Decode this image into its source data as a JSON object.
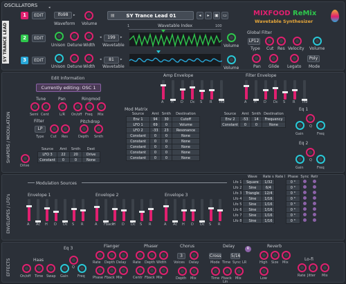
{
  "header": {
    "title": "OSCILLATORS",
    "preset_name": "SY Trance Lead 01"
  },
  "brand": {
    "name_a": "MIXFOOD",
    "name_b": "ReMix",
    "subtitle": "Wavetable Synthesizer",
    "vertical_logo": "SY TRANCE LEAD"
  },
  "colors": {
    "accent_pink": "#e0206f",
    "accent_cyan": "#28c9d8",
    "osc1": "#e0206f",
    "osc2": "#2ec74c",
    "osc3": "#28a7d8"
  },
  "osc1": {
    "num": "1",
    "edit": "EDIT",
    "waveform_value": "lfo98",
    "waveform_label": "Waveform",
    "volume_label": "Volume"
  },
  "osc2": {
    "num": "2",
    "edit": "EDIT",
    "wavetable_value": "199",
    "labels": [
      "Unison",
      "Detune",
      "Width",
      "Wavetable",
      "Volume"
    ]
  },
  "osc3": {
    "num": "3",
    "edit": "EDIT",
    "wavetable_value": "81",
    "labels": [
      "Unison",
      "Detune",
      "Width",
      "Wavetable",
      "Volume"
    ]
  },
  "wavetable_index": {
    "label": "Wavetable Index",
    "min": "1",
    "max": "100"
  },
  "global_filter": {
    "title": "Global Filter",
    "type_value": "LP12",
    "type_label": "Type",
    "cut_label": "Cut",
    "res_label": "Res",
    "velocity_label": "Velocity",
    "volume_label": "Volume",
    "pan_label": "Pan",
    "glide_label": "Glide",
    "legato_label": "Legato",
    "mode_value": "Poly",
    "mode_label": "Mode"
  },
  "edit_info": {
    "title": "Edit Information",
    "currently": "Currently editing: OSC 1"
  },
  "tune": {
    "title": "Tune",
    "semi": "Semi",
    "cent": "Cent"
  },
  "pan": {
    "title": "Pan",
    "lr": "L/R"
  },
  "ringmod": {
    "title": "Ringmod",
    "onoff": "On/off",
    "freq": "Freq",
    "mix": "Mix"
  },
  "filter": {
    "title": "Filter",
    "type_value": "LP",
    "type": "Type",
    "cut": "Cut",
    "res": "Res"
  },
  "pitchdrop": {
    "title": "Pitchdrop",
    "depth": "Depth",
    "smth": "Smth"
  },
  "drive": {
    "label": "Drive"
  },
  "source_table": {
    "headers": [
      "Source",
      "Amt",
      "Smth",
      "Dest"
    ],
    "rows": [
      [
        "LFO 3",
        "22",
        "20",
        "Drive"
      ],
      [
        "Constant",
        "0",
        "0",
        "None"
      ]
    ]
  },
  "amp_envelope": {
    "title": "Amp Envelope",
    "labels": [
      "A",
      "H",
      "D",
      "Dc",
      "S",
      "R",
      "Inv"
    ],
    "levels": [
      0.75,
      0.0,
      0.55,
      0.65,
      0.45,
      0.5,
      0.0
    ]
  },
  "filter_envelope": {
    "title": "Filter Envelope",
    "labels": [
      "A",
      "H",
      "D",
      "Dc",
      "S",
      "R",
      "Inv"
    ],
    "levels": [
      0.7,
      0.0,
      0.5,
      0.6,
      0.4,
      0.5,
      0.0
    ]
  },
  "mod_matrix": {
    "title": "Mod Matrix",
    "headers": [
      "Source",
      "Amt",
      "Smth",
      "Destination"
    ],
    "rows": [
      [
        "Env 1",
        "94",
        "30",
        "Cutoff"
      ],
      [
        "LFO 1",
        "69",
        "0",
        "Volume"
      ],
      [
        "LFO 2",
        "-33",
        "23",
        "Resonance"
      ],
      [
        "Constant",
        "0",
        "0",
        "None"
      ],
      [
        "Constant",
        "0",
        "0",
        "None"
      ],
      [
        "Constant",
        "0",
        "0",
        "None"
      ],
      [
        "Constant",
        "0",
        "0",
        "None"
      ],
      [
        "Constant",
        "0",
        "0",
        "None"
      ]
    ]
  },
  "mod2": {
    "headers": [
      "Source",
      "Amt",
      "Smth",
      "Destination"
    ],
    "rows": [
      [
        "Env 2",
        "-53",
        "14",
        "Frequency"
      ],
      [
        "Constant",
        "0",
        "0",
        "None"
      ]
    ]
  },
  "eq1": {
    "title": "Eq 1",
    "gain": "Gain",
    "q": "Q",
    "freq": "Freq"
  },
  "eq2": {
    "title": "Eq 2",
    "gain": "Gain",
    "q": "Q",
    "freq": "Freq"
  },
  "side_labels": {
    "shapers": "SHAPERS / MODULATION",
    "envelopes": "ENVELOPES / LFO's",
    "effects": "EFFECTS"
  },
  "mod_sources": {
    "title": "Modulation Sources"
  },
  "envelopes": [
    {
      "title": "Envelope 1",
      "labels": [
        "A",
        "Ac",
        "H",
        "D",
        "Dc",
        "S",
        "R"
      ],
      "levels": [
        0.7,
        0.0,
        0.6,
        0.45,
        0.0,
        0.55,
        0.5
      ]
    },
    {
      "title": "Envelope 2",
      "labels": [
        "A",
        "Fback",
        "H",
        "D",
        "Dc",
        "S",
        "R"
      ],
      "levels": [
        0.65,
        0.0,
        0.55,
        0.5,
        0.0,
        0.45,
        0.55
      ]
    },
    {
      "title": "Envelope 3",
      "labels": [
        "A",
        "Ac",
        "H",
        "D",
        "Dc",
        "S",
        "R"
      ],
      "levels": [
        0.7,
        0.0,
        0.5,
        0.5,
        0.0,
        0.6,
        0.5
      ]
    }
  ],
  "lfo_table": {
    "headers": [
      "Wave",
      "Rate s",
      "Rate l",
      "Phase",
      "Sync",
      "Retr"
    ],
    "rows": [
      [
        "Lfo 1",
        "Square",
        "1/32",
        "0 °"
      ],
      [
        "Lfo 2",
        "Sine",
        "6/4",
        "0 °"
      ],
      [
        "Lfo 3",
        "Triangle",
        "12/4",
        "0 °"
      ],
      [
        "Lfo 4",
        "Sine",
        "1/16",
        "0 °"
      ],
      [
        "Lfo 5",
        "Sine",
        "1/16",
        "0 °"
      ],
      [
        "Lfo 6",
        "Sine",
        "1/16",
        "0 °"
      ],
      [
        "Lfo 7",
        "Sine",
        "1/16",
        "0 °"
      ],
      [
        "Lfo 8",
        "Sine",
        "1/16",
        "0 °"
      ]
    ]
  },
  "effects": {
    "haas": {
      "title": "Haas",
      "labels": [
        "On/off",
        "Time",
        "Swap"
      ]
    },
    "eq3": {
      "title": "Eq 3",
      "labels": [
        "Gain",
        "Q",
        "Freq"
      ]
    },
    "flanger": {
      "title": "Flanger",
      "labels": [
        "Rate",
        "Depth",
        "Delay",
        "Phase",
        "Fback",
        "Mix"
      ]
    },
    "phaser": {
      "title": "Phaser",
      "labels": [
        "Rate",
        "Depth",
        "Width",
        "Centr",
        "Fback",
        "Mix"
      ]
    },
    "chorus": {
      "title": "Chorus",
      "voices_value": "3",
      "labels": [
        "Voices",
        "Delay",
        "Depth",
        "Mix"
      ]
    },
    "delay": {
      "title": "Delay",
      "mode_value": "Cross",
      "time_value": "5/16",
      "labels": [
        "Mode",
        "Time",
        "Sync",
        "Time",
        "Fback",
        "Mix"
      ],
      "lr": "LR",
      "lin": "Lin"
    },
    "reverb": {
      "title": "Reverb",
      "labels": [
        "High",
        "Size",
        "Mix",
        "Low"
      ]
    },
    "lofi": {
      "title": "Lo-fi",
      "labels": [
        "Rate",
        "Jitter",
        "Mix"
      ]
    }
  }
}
